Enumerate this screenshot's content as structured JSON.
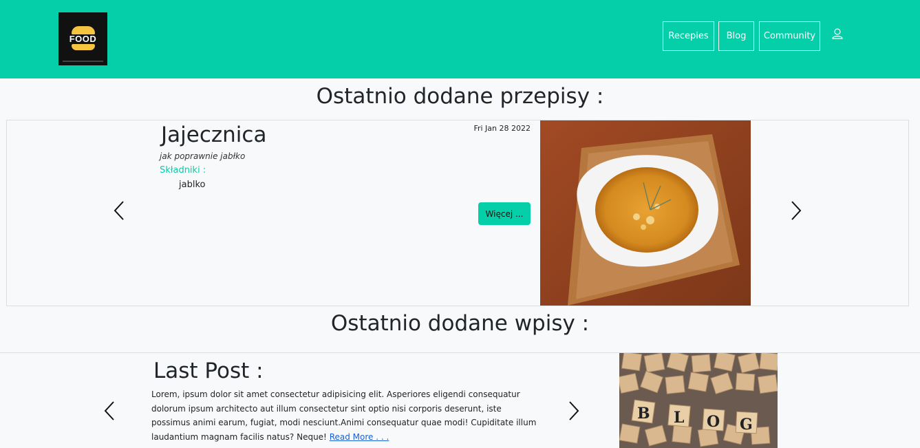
{
  "header": {
    "logo_text": "FOOD",
    "nav": [
      {
        "label": "Recepies"
      },
      {
        "label": "Blog"
      },
      {
        "label": "Community"
      }
    ],
    "user_icon": "user-icon",
    "colors": {
      "accent": "#05cfa8",
      "logo_bg": "#111111",
      "logo_bun": "#f5c542"
    }
  },
  "recipes_section": {
    "title": "Ostatnio dodane przepisy :",
    "recipe": {
      "title": "Jajecznica",
      "subtitle": "jak poprawnie jabłko",
      "ingredients_label": "Składniki :",
      "ingredients": [
        "jablko"
      ],
      "date": "Fri Jan 28 2022",
      "more_label": "Więcej ..."
    },
    "prev_icon": "chevron-left-icon",
    "next_icon": "chevron-right-icon"
  },
  "posts_section": {
    "title": "Ostatnio dodane wpisy :",
    "post": {
      "title": "Last Post :",
      "body": "Lorem, ipsum dolor sit amet consectetur adipisicing elit. Asperiores eligendi consequatur dolorum ipsum architecto aut illum consectetur sint optio nisi corporis deserunt, iste possimus animi earum, fugiat, modi nesciunt.Animi consequatur quae modi! Cupiditate illum laudantium magnam facilis natus? Neque!",
      "read_more": "Read More . . .",
      "image_letters": [
        "B",
        "L",
        "O",
        "G"
      ]
    }
  }
}
